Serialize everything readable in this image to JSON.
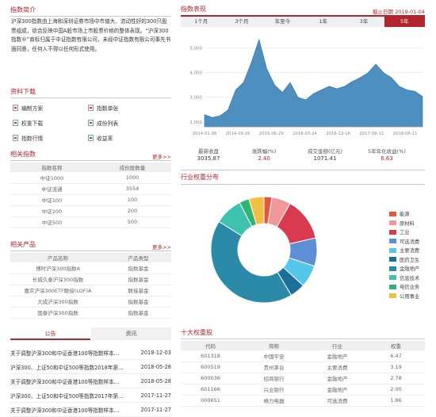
{
  "left": {
    "intro": {
      "title": "指数简介",
      "text": "沪深300指数由上海和深圳证券市场中市值大、流动性好的300只股票组成，综合反映中国A股市场上市股票价格的整体表现。“沪深300指数®”商标归属于中证指数有限公司，未经中证指数有限公司事先书面同意，任何人不得以任何形式使用。"
    },
    "downloads": {
      "title": "资料下载",
      "items": [
        {
          "label": "编制方案",
          "icon": "pdf-icon"
        },
        {
          "label": "指数单张",
          "icon": "pdf-icon"
        },
        {
          "label": "权重下载",
          "icon": "excel-icon"
        },
        {
          "label": "成份列表",
          "icon": "excel-icon"
        },
        {
          "label": "指数行情",
          "icon": "excel-icon"
        },
        {
          "label": "收益率",
          "icon": "excel-icon"
        }
      ]
    },
    "related_indices": {
      "title": "相关指数",
      "more": "更多>>",
      "headers": [
        "指数名称",
        "成份股数量"
      ],
      "rows": [
        [
          "中证1000",
          "1000"
        ],
        [
          "中证流通",
          "3554"
        ],
        [
          "中证100",
          "100"
        ],
        [
          "中证200",
          "200"
        ],
        [
          "中证500",
          "500"
        ]
      ]
    },
    "related_products": {
      "title": "相关产品",
      "more": "更多>>",
      "headers": [
        "产品名称",
        "产品类型"
      ],
      "rows": [
        [
          "博时沪深300指数A",
          "指数基金"
        ],
        [
          "长城久泰沪深300指数",
          "指数基金"
        ],
        [
          "嘉实沪深300ETF联接(LOF)A",
          "联接基金"
        ],
        [
          "大成沪深300指数",
          "指数基金"
        ],
        [
          "国泰沪深300指数",
          "指数基金"
        ]
      ]
    },
    "news": {
      "tabs": [
        "公告",
        "资讯"
      ],
      "rows": [
        [
          "关于调整沪深300和中证香港100等指数样本…",
          "2018-12-03"
        ],
        [
          "沪深300、上证50和中证500等指数2018年第…",
          "2018-05-28"
        ],
        [
          "关于调整沪深300和中证香港100等指数样本…",
          "2018-05-28"
        ],
        [
          "沪深300、上证50和中证500等指数2017年第…",
          "2017-11-27"
        ],
        [
          "关于调整沪深300和中证香港100等指数样本…",
          "2017-11-27"
        ]
      ]
    }
  },
  "right": {
    "performance": {
      "title": "指数表现",
      "date": "截止日期 2019-01-04",
      "ranges": [
        "1个月",
        "3个月",
        "年至今",
        "1年",
        "3年",
        "5年"
      ],
      "active_range": "5年"
    },
    "stats": [
      {
        "label": "最新收盘",
        "value": "3035.87",
        "color": "#333333"
      },
      {
        "label": "涨跌幅(%)",
        "value": "2.40",
        "color": "#b0262c"
      },
      {
        "label": "成交金额(亿元)",
        "value": "1071.41",
        "color": "#333333"
      },
      {
        "label": "5年年化收益(%)",
        "value": "6.63",
        "color": "#b0262c"
      }
    ],
    "industry": {
      "title": "行业权重分布"
    },
    "top10": {
      "title": "十大权重股",
      "headers": [
        "代码",
        "简称",
        "行业",
        "权重"
      ],
      "rows": [
        [
          "601318",
          "中国平安",
          "金融地产",
          "6.47"
        ],
        [
          "600519",
          "贵州茅台",
          "主要消费",
          "3.19"
        ],
        [
          "600036",
          "招商银行",
          "金融地产",
          "2.78"
        ],
        [
          "601166",
          "兴业银行",
          "金融地产",
          "2.00"
        ],
        [
          "000651",
          "格力电器",
          "可选消费",
          "1.86"
        ]
      ]
    }
  },
  "chart_data": [
    {
      "type": "area",
      "title": "",
      "x_tick_labels": [
        "2014-01-06",
        "2014-09-26",
        "2015-06-29",
        "2016-03-24",
        "2016-12-16",
        "2017-09-11",
        "2018-06-11"
      ],
      "y_tick_labels": [
        "2,000",
        "3,000",
        "4,000",
        "5,000"
      ],
      "ylim": [
        1800,
        5600
      ],
      "x": [
        "2014-01",
        "2014-04",
        "2014-07",
        "2014-10",
        "2014-12",
        "2015-02",
        "2015-04",
        "2015-06",
        "2015-07",
        "2015-08",
        "2015-09",
        "2015-11",
        "2016-01",
        "2016-02",
        "2016-05",
        "2016-08",
        "2016-11",
        "2017-01",
        "2017-04",
        "2017-07",
        "2017-09",
        "2017-11",
        "2018-01",
        "2018-03",
        "2018-05",
        "2018-07",
        "2018-09",
        "2018-11",
        "2019-01"
      ],
      "values": [
        2300,
        2180,
        2250,
        2480,
        3300,
        3600,
        4400,
        5350,
        4150,
        3500,
        3200,
        3600,
        3000,
        2900,
        3150,
        3300,
        3450,
        3350,
        3450,
        3650,
        3800,
        4000,
        4350,
        4000,
        3800,
        3450,
        3300,
        3250,
        3035
      ],
      "color": "#3e85b8",
      "grid": true
    },
    {
      "type": "pie",
      "donut": true,
      "categories": [
        "能源",
        "原材料",
        "工业",
        "可选消费",
        "主要消费",
        "医药卫生",
        "金融地产",
        "信息技术",
        "电信业务",
        "公用事业"
      ],
      "values": [
        2.4,
        5.8,
        13.2,
        8.6,
        6.8,
        4.6,
        42.5,
        8.5,
        3.0,
        4.6
      ],
      "colors": [
        "#e2573e",
        "#f09898",
        "#d93a50",
        "#5c8fd6",
        "#55c7ea",
        "#1b6f9a",
        "#2a8aa8",
        "#3fc1b0",
        "#2fb472",
        "#f0c043"
      ],
      "legend": "right"
    }
  ]
}
